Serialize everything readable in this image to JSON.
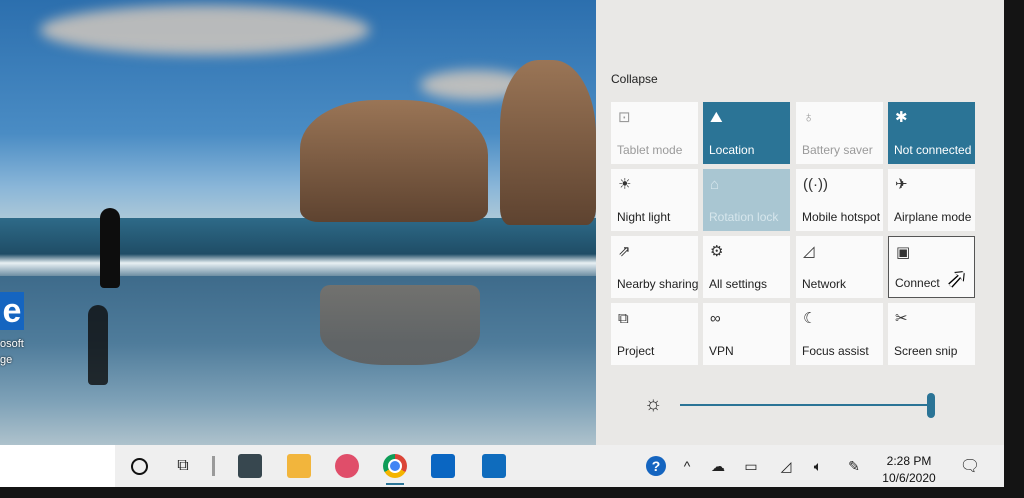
{
  "desktop": {
    "icon_glyph": "e",
    "icon_label_line1": "osoft",
    "icon_label_line2": "ge"
  },
  "action_center": {
    "collapse_label": "Collapse",
    "tiles": [
      {
        "label": "Tablet mode",
        "icon": "tablet-mode-icon",
        "glyph": "⊡",
        "state": "off-dim"
      },
      {
        "label": "Location",
        "icon": "location-icon",
        "glyph": "⛰",
        "state": "on"
      },
      {
        "label": "Battery saver",
        "icon": "battery-saver-icon",
        "glyph": "♁",
        "state": "off-dim"
      },
      {
        "label": "Not connected",
        "icon": "bluetooth-icon",
        "glyph": "✱",
        "state": "on"
      },
      {
        "label": "Night light",
        "icon": "night-light-icon",
        "glyph": "☀",
        "state": "off"
      },
      {
        "label": "Rotation lock",
        "icon": "rotation-lock-icon",
        "glyph": "⌂",
        "state": "disabled"
      },
      {
        "label": "Mobile hotspot",
        "icon": "mobile-hotspot-icon",
        "glyph": "((·))",
        "state": "off"
      },
      {
        "label": "Airplane mode",
        "icon": "airplane-icon",
        "glyph": "✈",
        "state": "off"
      },
      {
        "label": "Nearby sharing",
        "icon": "nearby-sharing-icon",
        "glyph": "⇗",
        "state": "off"
      },
      {
        "label": "All settings",
        "icon": "gear-icon",
        "glyph": "⚙",
        "state": "off"
      },
      {
        "label": "Network",
        "icon": "network-icon",
        "glyph": "◿",
        "state": "off"
      },
      {
        "label": "Connect",
        "icon": "connect-icon",
        "glyph": "▣",
        "state": "focused"
      },
      {
        "label": "Project",
        "icon": "project-icon",
        "glyph": "⧉",
        "state": "off"
      },
      {
        "label": "VPN",
        "icon": "vpn-icon",
        "glyph": "∞",
        "state": "off"
      },
      {
        "label": "Focus assist",
        "icon": "focus-assist-icon",
        "glyph": "☾",
        "state": "off"
      },
      {
        "label": "Screen snip",
        "icon": "screen-snip-icon",
        "glyph": "✂",
        "state": "off"
      }
    ],
    "brightness": {
      "icon": "brightness-icon",
      "glyph": "☼",
      "level": 1.0
    }
  },
  "taskbar": {
    "pinned_apps": [
      {
        "name": "Calculator",
        "icon": "calculator-icon",
        "color": "#37474f"
      },
      {
        "name": "File Explorer",
        "icon": "folder-icon",
        "color": "#f2b53c"
      },
      {
        "name": "Paint",
        "icon": "paint-icon",
        "color": "#e04e6a"
      },
      {
        "name": "Chrome",
        "icon": "chrome-icon",
        "color": "#db4437"
      },
      {
        "name": "Trello",
        "icon": "trello-icon",
        "color": "#0a66c2"
      },
      {
        "name": "Outlook",
        "icon": "outlook-icon",
        "color": "#0f6cbd"
      }
    ],
    "tray": {
      "help_glyph": "?",
      "chevron_glyph": "^",
      "time": "2:28 PM",
      "date": "10/6/2020"
    }
  },
  "colors": {
    "accent": "#2b7496",
    "panel_bg": "#e9e8e6",
    "tile_bg": "#fafafa",
    "taskbar_bg": "#efefef"
  }
}
